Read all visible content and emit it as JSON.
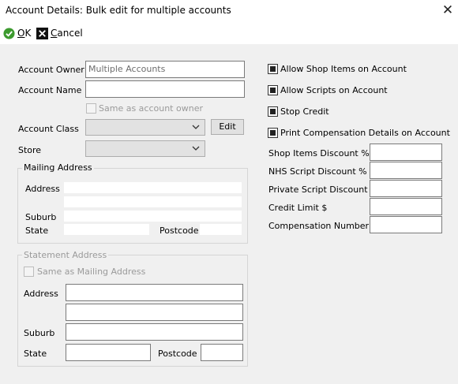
{
  "window": {
    "title": "Account Details: Bulk edit for multiple accounts"
  },
  "toolbar": {
    "ok_key": "O",
    "ok_rest": "K",
    "cancel_key": "C",
    "cancel_rest": "ancel"
  },
  "form": {
    "account_owner_label": "Account Owner",
    "account_owner_value": "Multiple Accounts",
    "account_name_label": "Account Name",
    "account_name_value": "",
    "same_as_owner_label": "Same as account owner",
    "account_class_label": "Account Class",
    "account_class_value": "",
    "edit_button": "Edit",
    "store_label": "Store",
    "store_value": ""
  },
  "mailing": {
    "legend": "Mailing Address",
    "address_label": "Address",
    "suburb_label": "Suburb",
    "state_label": "State",
    "postcode_label": "Postcode"
  },
  "statement": {
    "legend": "Statement Address",
    "same_as_mailing_label": "Same as Mailing Address",
    "address_label": "Address",
    "suburb_label": "Suburb",
    "state_label": "State",
    "postcode_label": "Postcode"
  },
  "options": {
    "allow_shop_items": {
      "label": "Allow Shop Items on Account",
      "checked": true
    },
    "allow_scripts": {
      "label": "Allow Scripts on Account",
      "checked": true
    },
    "stop_credit": {
      "label": "Stop Credit",
      "checked": true
    },
    "print_compensation": {
      "label": "Print Compensation Details on Account",
      "checked": true
    }
  },
  "fields": {
    "shop_items_discount_label": "Shop Items Discount %",
    "nhs_script_discount_label": "NHS Script Discount %",
    "private_script_discount_label": "Private Script Discount %",
    "credit_limit_label": "Credit Limit $",
    "compensation_number_label": "Compensation Number"
  },
  "icons": {
    "ok": "check-circle-icon",
    "cancel": "x-box-icon",
    "close": "close-icon",
    "dropdown": "chevron-down-icon"
  },
  "colors": {
    "ok_green": "#3c9a2e",
    "cancel_black": "#111111"
  }
}
